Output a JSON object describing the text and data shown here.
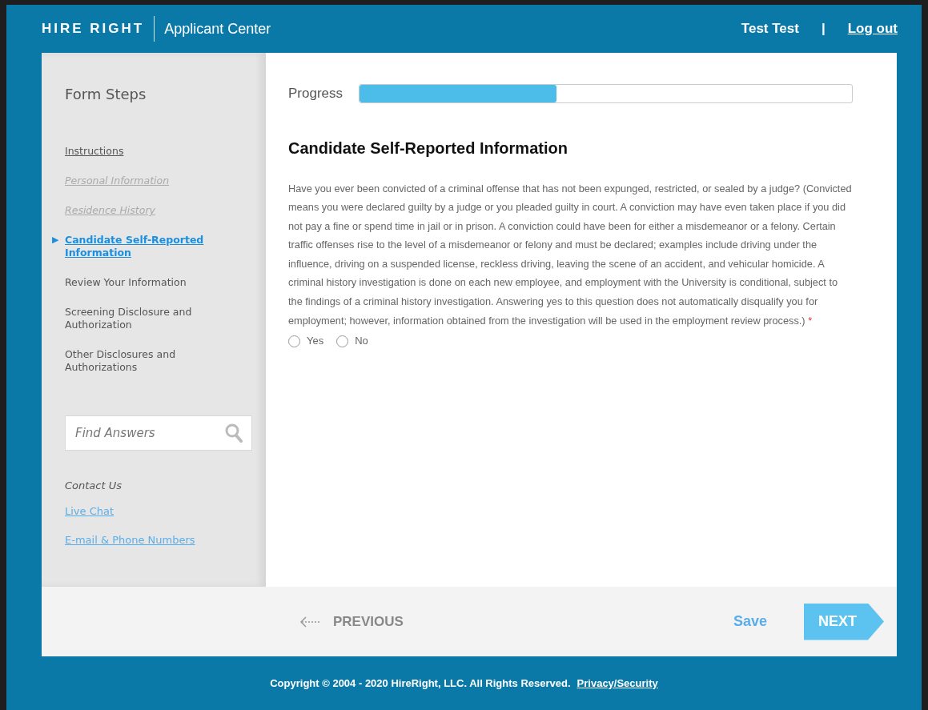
{
  "header": {
    "logo": "HIRE RIGHT",
    "app_name": "Applicant Center",
    "user": "Test Test",
    "separator": "|",
    "logout": "Log out"
  },
  "sidebar": {
    "title": "Form Steps",
    "steps": [
      {
        "label": "Instructions",
        "completed": true,
        "disabled": false,
        "selected": false
      },
      {
        "label": "Personal Information",
        "completed": false,
        "disabled": true,
        "selected": false
      },
      {
        "label": "Residence History",
        "completed": false,
        "disabled": true,
        "selected": false
      },
      {
        "label": "Candidate Self-Reported Information",
        "completed": false,
        "disabled": false,
        "selected": true
      },
      {
        "label": "Review Your Information",
        "completed": false,
        "disabled": false,
        "selected": false
      },
      {
        "label": "Screening Disclosure and Authorization",
        "completed": false,
        "disabled": false,
        "selected": false
      },
      {
        "label": "Other Disclosures and Authorizations",
        "completed": false,
        "disabled": false,
        "selected": false
      }
    ],
    "current_marker": "▶",
    "search": {
      "placeholder": "Find Answers"
    },
    "contact_title": "Contact Us",
    "links": [
      "Live Chat",
      "E-mail & Phone Numbers"
    ]
  },
  "main": {
    "progress_label": "Progress",
    "progress": {
      "level": 0.4
    },
    "title": "Candidate Self-Reported Information",
    "question": "Have you ever been convicted of a criminal offense that has not been expunged, restricted, or sealed by a judge? (Convicted means you were declared guilty by a judge or you pleaded guilty in court. A conviction may have even taken place if you did not pay a fine or spend time in jail or in prison. A conviction could have been for either a misdemeanor or a felony. Certain traffic offenses rise to the level of a misdemeanor or felony and must be declared; examples include driving under the influence, driving on a suspended license, reckless driving, leaving the scene of an accident, and vehicular homicide. A criminal history investigation is done on each new employee, and employment with the University is conditional, subject to the findings of a criminal history investigation. Answering yes to this question does not automatically disqualify you for employment; however, information obtained from the investigation will be used in the employment review process.)",
    "required_mark": "*",
    "options": [
      {
        "label": "Yes",
        "selected": false
      },
      {
        "label": "No",
        "selected": false
      }
    ]
  },
  "nav": {
    "previous": "PREVIOUS",
    "save": "Save",
    "next": "NEXT"
  },
  "footer": {
    "copyright": "Copyright © 2004 - 2020 HireRight, LLC. All Rights Reserved.",
    "privacy": "Privacy/Security"
  }
}
